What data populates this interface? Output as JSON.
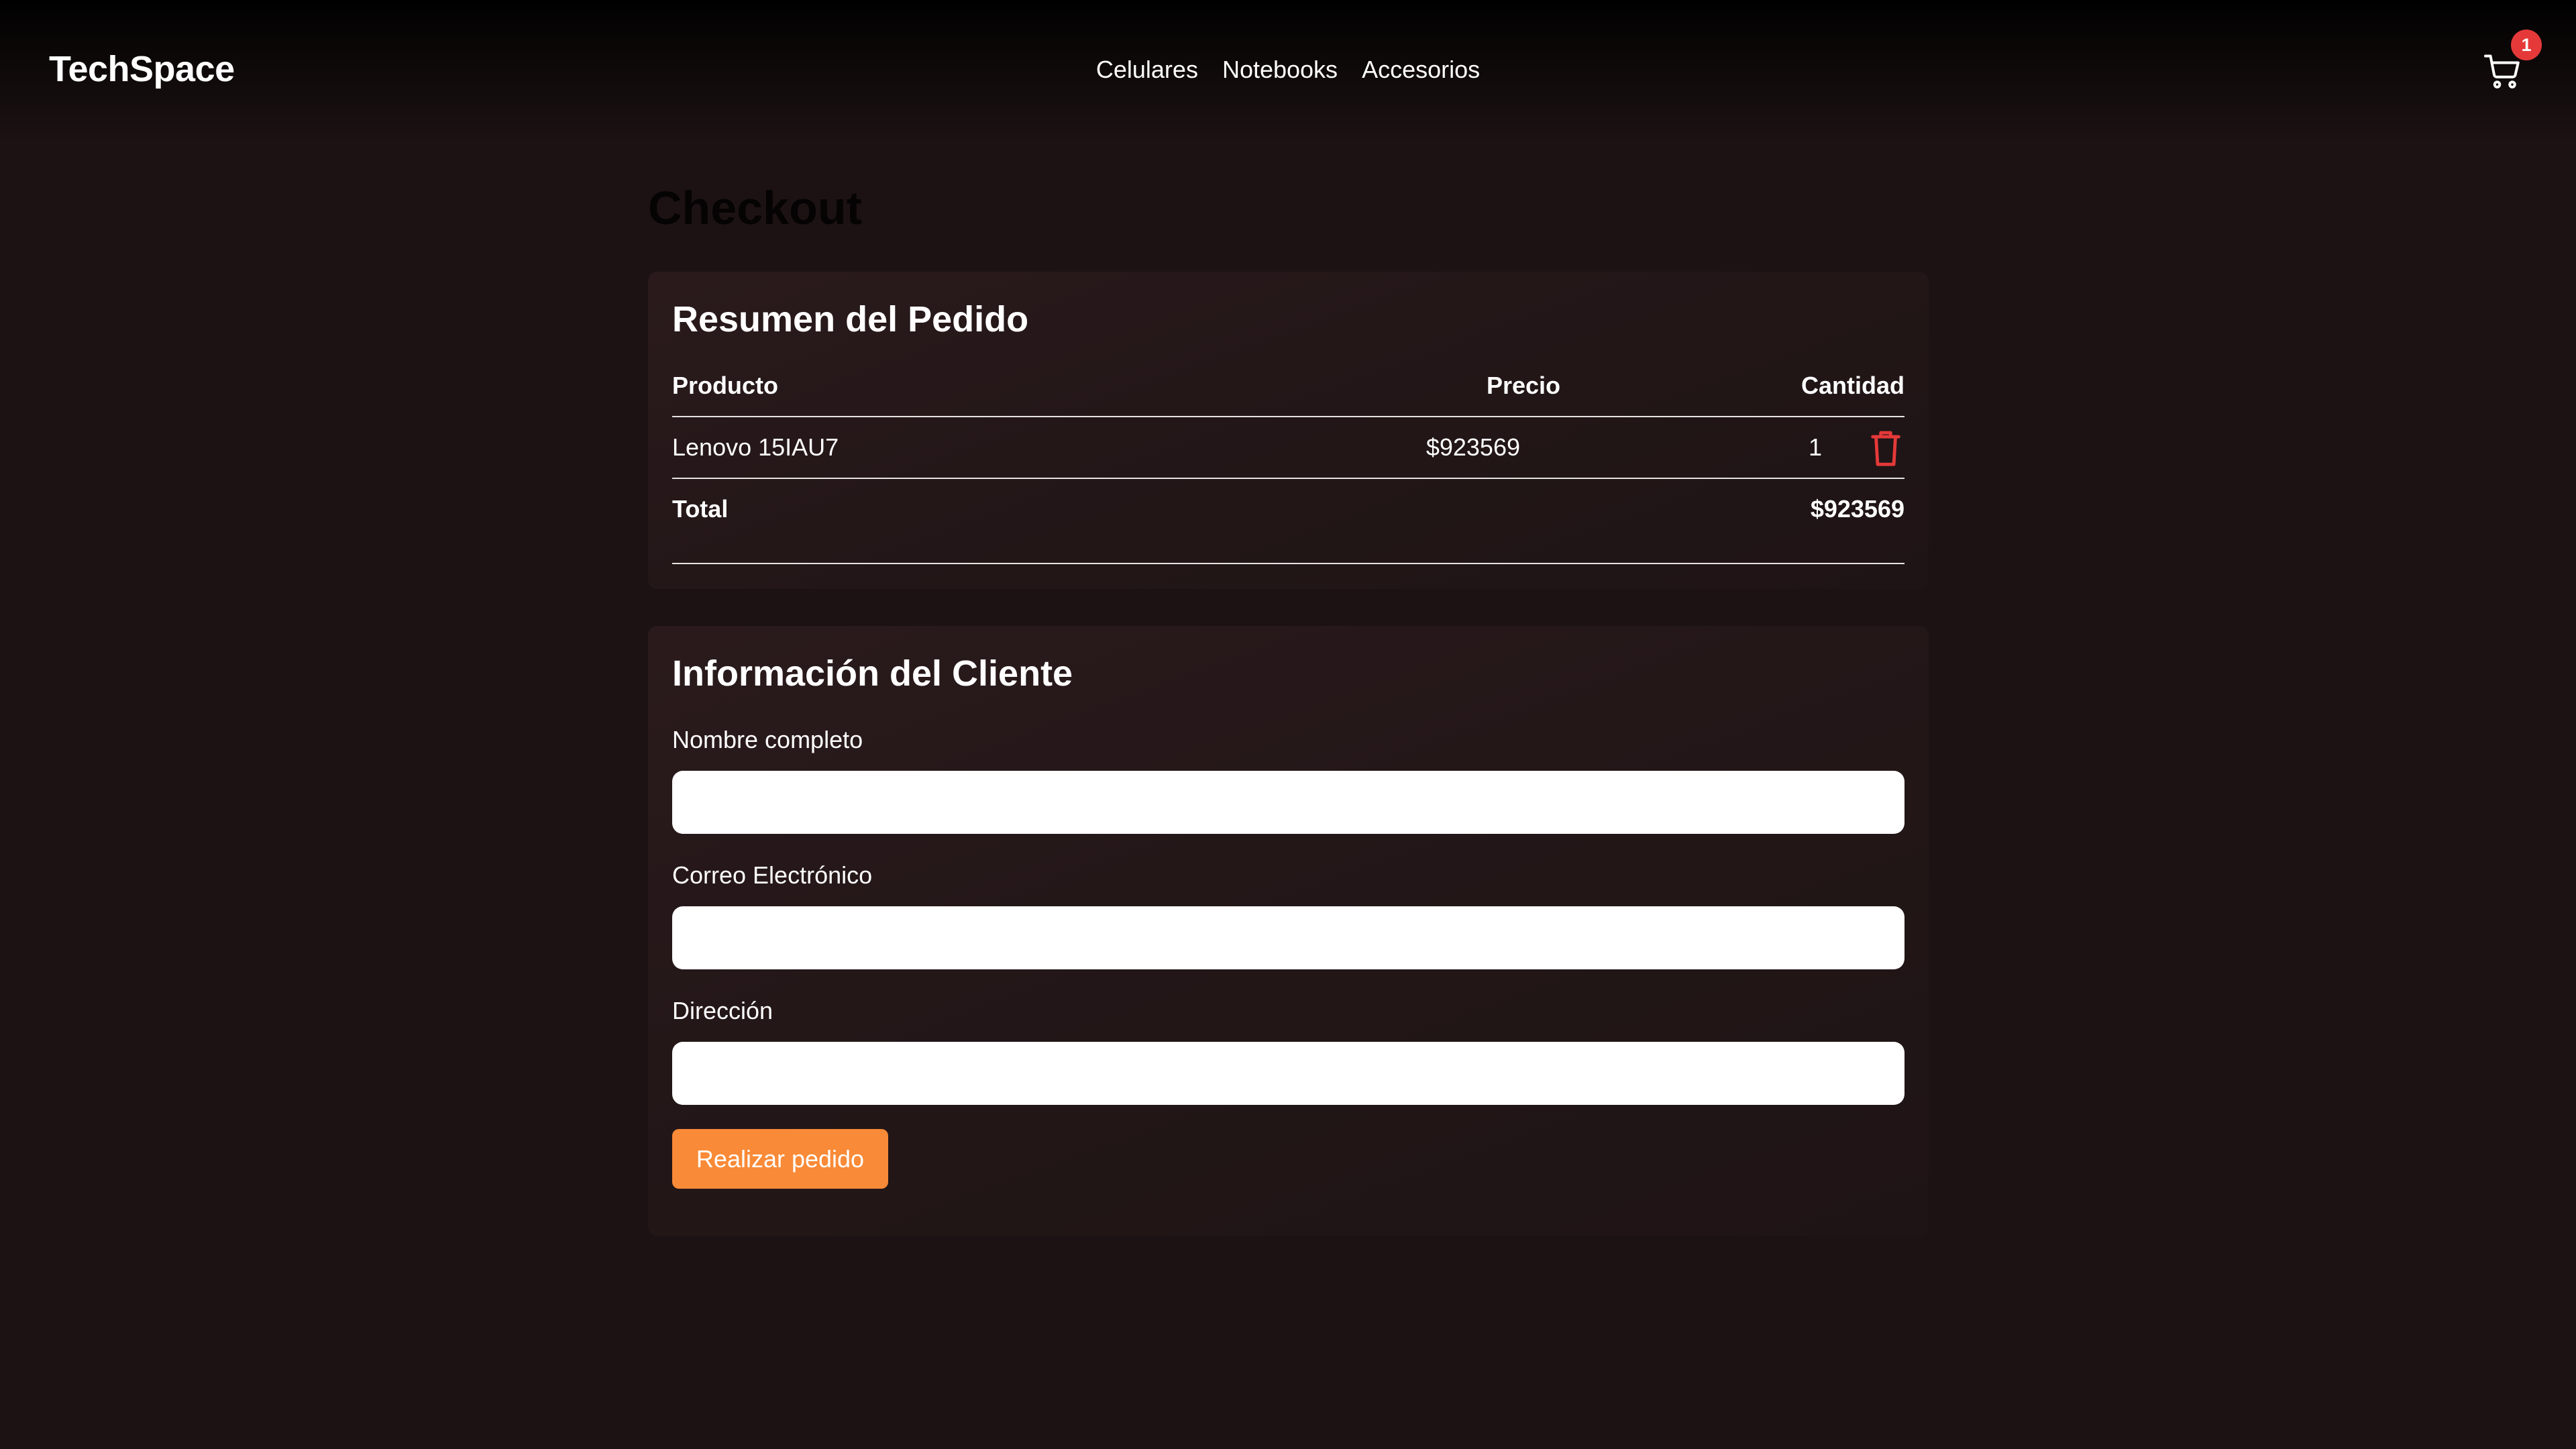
{
  "header": {
    "brand": "TechSpace",
    "nav": [
      "Celulares",
      "Notebooks",
      "Accesorios"
    ],
    "cart_count": "1",
    "cart_icon": "shopping-cart-icon"
  },
  "page_title": "Checkout",
  "summary": {
    "title": "Resumen del Pedido",
    "columns": [
      "Producto",
      "Precio",
      "Cantidad"
    ],
    "items": [
      {
        "product": "Lenovo 15IAU7",
        "price": "$923569",
        "quantity": "1",
        "remove_icon": "trash-icon"
      }
    ],
    "total_label": "Total",
    "total_value": "$923569"
  },
  "client": {
    "title": "Información del Cliente",
    "fields": [
      {
        "label": "Nombre completo",
        "value": ""
      },
      {
        "label": "Correo Electrónico",
        "value": ""
      },
      {
        "label": "Dirección",
        "value": ""
      }
    ],
    "submit_label": "Realizar pedido"
  },
  "colors": {
    "background": "#1c1213",
    "card": "#241718",
    "accent": "#f98a37",
    "danger": "#e53939"
  }
}
